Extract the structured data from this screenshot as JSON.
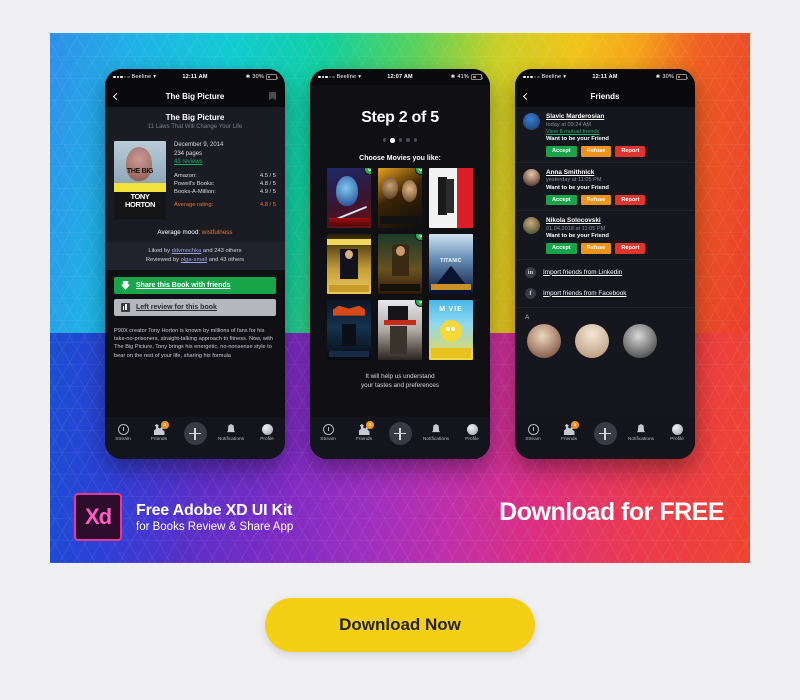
{
  "promo": {
    "xd_logo_text": "Xd",
    "headline": "Free Adobe XD UI Kit",
    "subheadline": "for Books Review & Share App",
    "download_free": "Download for FREE",
    "cta_label": "Download Now",
    "accent_pink": "#e2399b",
    "cta_color": "#f5cf16"
  },
  "phone1": {
    "status": {
      "carrier": "Beeline",
      "time": "12:11 AM",
      "battery": "30%"
    },
    "nav": {
      "title": "The Big Picture",
      "back_icon": "chevron-left-icon",
      "bookmark_icon": "bookmark-icon"
    },
    "book": {
      "title": "The Big Picture",
      "subtitle": "11 Laws That Will Change Your Life",
      "date": "December 9, 2014",
      "pages": "234 pages",
      "reviews_link": "43 reviews",
      "cover_title_1": "THE BIG",
      "cover_title_2": "PICTURE",
      "cover_author_1": "TONY",
      "cover_author_2": "HORTON",
      "ratings": [
        {
          "source": "Amazon:",
          "value": "4.5 / 5"
        },
        {
          "source": "Powell's Books:",
          "value": "4.8 / 5"
        },
        {
          "source": "Books-A-Million:",
          "value": "4.9 / 5"
        }
      ],
      "average_label": "Average rating:",
      "average_value": "4.8 / 5",
      "mood_label": "Average mood:",
      "mood_value": "wistfulness",
      "liked_by_prefix": "Liked by",
      "liked_by_user": "ddvmochka",
      "liked_by_suffix": "and 243 others",
      "reviewed_by_prefix": "Reviewed by",
      "reviewed_by_user": "olga-small",
      "reviewed_by_suffix": "and 43 others",
      "share_button": "Share this Book with friends",
      "review_button": "Left review for this book",
      "description": "P90X creator Tony Horton is known by millions of fans for his take-no-prisoners, straight-talking approach to fitness. Now, with The Big Picture, Tony brings his energetic, no-nonsense style to bear on the rest of your life, sharing his formula"
    }
  },
  "phone2": {
    "status": {
      "carrier": "Beeline",
      "time": "12:07 AM",
      "battery": "41%"
    },
    "step_title": "Step 2 of 5",
    "dots_total": 5,
    "dots_active": 2,
    "choose_label": "Choose Movies you like:",
    "help_line_1": "It will help us understand",
    "help_line_2": "your tastes and preferences",
    "movies": [
      {
        "name": "Elektra",
        "selected": true
      },
      {
        "name": "The Thomas Crown Affair",
        "selected": true
      },
      {
        "name": "Mr. & Mrs. Smith",
        "selected": false
      },
      {
        "name": "The Wolf of Wall Street",
        "selected": false
      },
      {
        "name": "Pirates of the Caribbean",
        "selected": true
      },
      {
        "name": "Titanic",
        "selected": false
      },
      {
        "name": "The Dark Knight Rises",
        "selected": false
      },
      {
        "name": "Leon The Professional",
        "selected": true
      },
      {
        "name": "The Simpsons Movie",
        "selected": false
      }
    ]
  },
  "phone3": {
    "status": {
      "carrier": "Beeline",
      "time": "12:11 AM",
      "battery": "30%"
    },
    "nav": {
      "title": "Friends",
      "back_icon": "chevron-left-icon"
    },
    "requests": [
      {
        "name": "Slavic Marderosian",
        "time": "today at 09:24 AM",
        "mutual": "View 8 mutual friends",
        "message": "Want to be your Friend",
        "accept": "Accept",
        "refuse": "Refuse",
        "report": "Report"
      },
      {
        "name": "Anna Smithnick",
        "time": "yesterday at 11:05 PM",
        "mutual": "",
        "message": "Want to be your Friend",
        "accept": "Accept",
        "refuse": "Refuse",
        "report": "Report"
      },
      {
        "name": "Nikola Solocovski",
        "time": "01.04.2018 at 11:05 PM",
        "mutual": "",
        "message": "Want to be your Friend",
        "accept": "Accept",
        "refuse": "Refuse",
        "report": "Report"
      }
    ],
    "imports": [
      {
        "icon": "linkedin-icon",
        "glyph": "in",
        "label": "Import friends from Linkedin"
      },
      {
        "icon": "facebook-icon",
        "glyph": "f",
        "label": "Import friends from Facebook"
      }
    ],
    "letter_section": "A"
  },
  "tabbar": {
    "items": [
      {
        "label": "Stream",
        "icon": "clock-icon",
        "badge": ""
      },
      {
        "label": "Friends",
        "icon": "people-icon",
        "badge": "3"
      },
      {
        "label": "Notifications",
        "icon": "bell-icon",
        "badge": ""
      },
      {
        "label": "Profile",
        "icon": "globe-icon",
        "badge": ""
      }
    ],
    "add_icon": "plus-icon"
  }
}
